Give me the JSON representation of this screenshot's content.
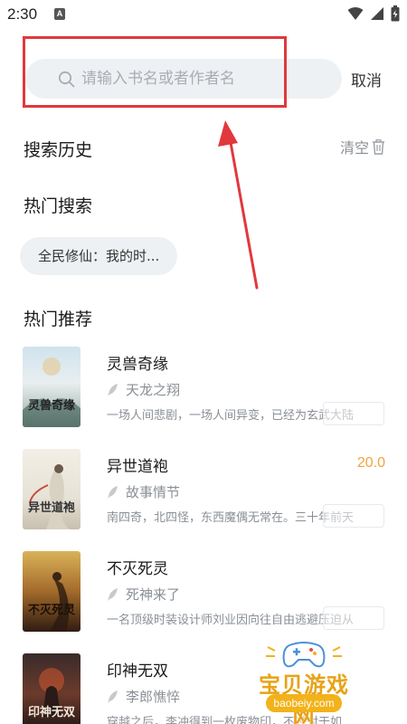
{
  "status_bar": {
    "time": "2:30",
    "a_icon": "A"
  },
  "search": {
    "placeholder": "请输入书名或者作者名",
    "value": "",
    "cancel_label": "取消"
  },
  "history": {
    "title": "搜索历史",
    "clear_label": "清空"
  },
  "hot_search": {
    "title": "热门搜索",
    "items": [
      "全民修仙：我的时..."
    ]
  },
  "recommend": {
    "title": "热门推荐",
    "books": [
      {
        "title": "灵兽奇缘",
        "cover_text": "灵兽奇缘",
        "author": "天龙之翔",
        "desc": "一场人间悲剧，一场人间异变，已经为玄武大陆",
        "score": ""
      },
      {
        "title": "异世道袍",
        "cover_text": "异世道袍",
        "author": "故事情节",
        "desc": "南四奇，北四怪，东西魔偶无常在。三十年前天",
        "score": "20.0"
      },
      {
        "title": "不灭死灵",
        "cover_text": "不灭死灵",
        "author": "死神来了",
        "desc": "一名顶级时装设计师刘业因向往自由逃避压迫从",
        "score": ""
      },
      {
        "title": "印神无双",
        "cover_text": "印神无双",
        "author": "李郎憔悴",
        "desc": "穿越之后，李冲得到一枚废物印，不过对于如",
        "score": ""
      }
    ]
  },
  "watermark": {
    "text": "宝贝游戏网",
    "url": "baobeiy.com"
  },
  "colors": {
    "accent_red": "#e1383d",
    "score_orange": "#f2a23a",
    "chip_bg": "#eef1f4"
  }
}
